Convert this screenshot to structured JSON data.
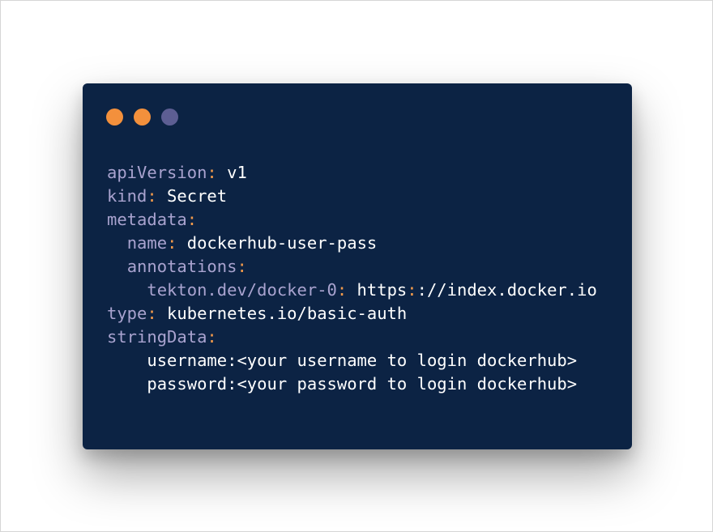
{
  "window": {
    "dots": [
      {
        "name": "dot-1",
        "color": "#f3903c"
      },
      {
        "name": "dot-2",
        "color": "#f3903c"
      },
      {
        "name": "dot-3",
        "color": "#5d5e93"
      }
    ]
  },
  "code": {
    "lines": [
      {
        "indent": "",
        "key": "apiVersion",
        "sep": ":",
        "value": " v1"
      },
      {
        "indent": "",
        "key": "kind",
        "sep": ":",
        "value": " Secret"
      },
      {
        "indent": "",
        "key": "metadata",
        "sep": ":",
        "value": ""
      },
      {
        "indent": "  ",
        "key": "name",
        "sep": ":",
        "value": " dockerhub-user-pass"
      },
      {
        "indent": "  ",
        "key": "annotations",
        "sep": ":",
        "value": ""
      },
      {
        "indent": "    ",
        "key": "tekton.dev/docker-0",
        "sep": ":",
        "value_parts": [
          " https",
          "://index.docker.io"
        ],
        "value_sep": ":"
      },
      {
        "indent": "",
        "key": "type",
        "sep": ":",
        "value": " kubernetes.io/basic-auth"
      },
      {
        "indent": "",
        "key": "stringData",
        "sep": ":",
        "value": ""
      },
      {
        "indent": "    ",
        "plain": "username:<your username to login dockerhub>"
      },
      {
        "indent": "    ",
        "plain": "password:<your password to login dockerhub>"
      }
    ]
  },
  "colors": {
    "background": "#0c2344",
    "key": "#a9a3cf",
    "punctuation": "#f29a4b",
    "value": "#ffffff"
  }
}
